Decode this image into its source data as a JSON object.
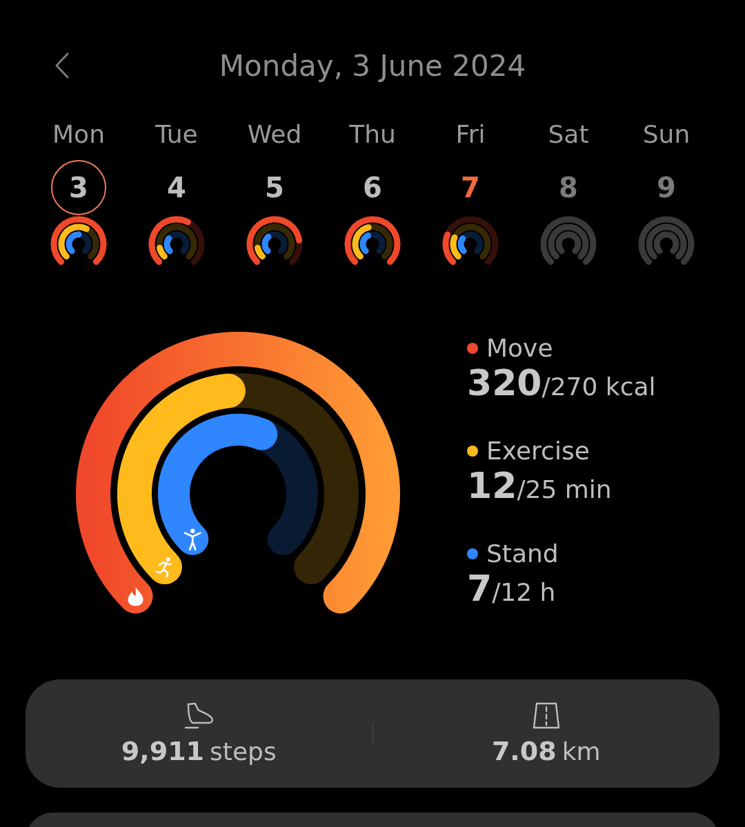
{
  "header": {
    "title": "Monday, 3 June 2024"
  },
  "days": [
    {
      "name": "Mon",
      "date": "3",
      "selected": true,
      "today": false,
      "future": false
    },
    {
      "name": "Tue",
      "date": "4",
      "selected": false,
      "today": false,
      "future": false
    },
    {
      "name": "Wed",
      "date": "5",
      "selected": false,
      "today": false,
      "future": false
    },
    {
      "name": "Thu",
      "date": "6",
      "selected": false,
      "today": false,
      "future": false
    },
    {
      "name": "Fri",
      "date": "7",
      "selected": false,
      "today": true,
      "future": false
    },
    {
      "name": "Sat",
      "date": "8",
      "selected": false,
      "today": false,
      "future": true
    },
    {
      "name": "Sun",
      "date": "9",
      "selected": false,
      "today": false,
      "future": true
    }
  ],
  "metrics": [
    {
      "kind": "move",
      "label": "Move",
      "value": "320",
      "goal": "/270 kcal",
      "color": "#f0482a"
    },
    {
      "kind": "exercise",
      "label": "Exercise",
      "value": "12",
      "goal": "/25 min",
      "color": "#ffbb1c"
    },
    {
      "kind": "stand",
      "label": "Stand",
      "value": "7",
      "goal": "/12 h",
      "color": "#2f86ff"
    }
  ],
  "stats": [
    {
      "kind": "steps",
      "value": "9,911",
      "unit": "steps"
    },
    {
      "kind": "distance",
      "value": "7.08",
      "unit": "km"
    }
  ]
}
